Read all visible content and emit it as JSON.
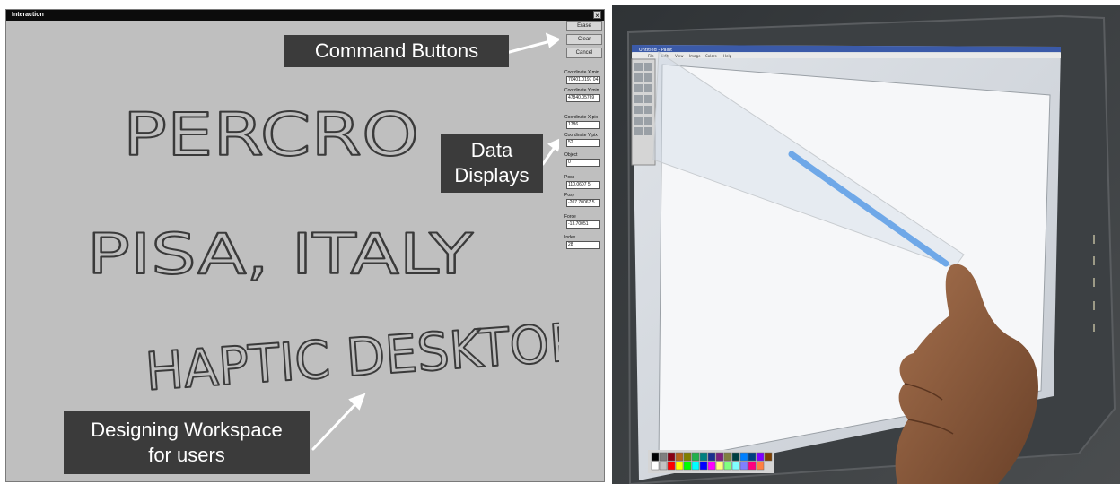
{
  "window": {
    "title": "Interaction",
    "close_glyph": "×"
  },
  "command_buttons": [
    "Erase",
    "Clear",
    "Cancel"
  ],
  "data_displays": [
    {
      "label": "Coordinate X min",
      "value": "70401.0197 04"
    },
    {
      "label": "Coordinate Y min",
      "value": "47840.05769"
    },
    {
      "label": "Coordinate X pix",
      "value": "1786"
    },
    {
      "label": "Coordinate Y pix",
      "value": "52"
    },
    {
      "label": "Object",
      "value": "0"
    },
    {
      "label": "Posx",
      "value": "110.0607 5"
    },
    {
      "label": "Posy",
      "value": "-207.70067 5"
    },
    {
      "label": "Force",
      "value": "-13.70051"
    },
    {
      "label": "Index",
      "value": "28"
    }
  ],
  "handwriting": {
    "line1": "PERCRO",
    "line2": "PISA, ITALY",
    "line3": "HAPTIC DESKTOP"
  },
  "callouts": {
    "command_buttons": "Command Buttons",
    "data_displays_line1": "Data",
    "data_displays_line2": "Displays",
    "workspace_line1": "Designing Workspace",
    "workspace_line2": "for users"
  },
  "photo": {
    "paint_title": "Untitled - Paint",
    "menu": [
      "File",
      "Edit",
      "View",
      "Image",
      "Colors",
      "Help"
    ],
    "palette_colors": [
      "#000000",
      "#7f7f7f",
      "#880015",
      "#b5651d",
      "#808000",
      "#22b14c",
      "#008080",
      "#1a2f8f",
      "#7f1f7f",
      "#808040",
      "#004040",
      "#0080ff",
      "#004080",
      "#8000ff",
      "#804000",
      "#ffffff",
      "#c3c3c3",
      "#ff0000",
      "#ffff00",
      "#00ff00",
      "#00ffff",
      "#0000ff",
      "#ff00ff",
      "#ffff80",
      "#80ff80",
      "#80ffff",
      "#8080ff",
      "#ff0080",
      "#ff8040"
    ],
    "stroke_color": "#6fa8e8"
  }
}
